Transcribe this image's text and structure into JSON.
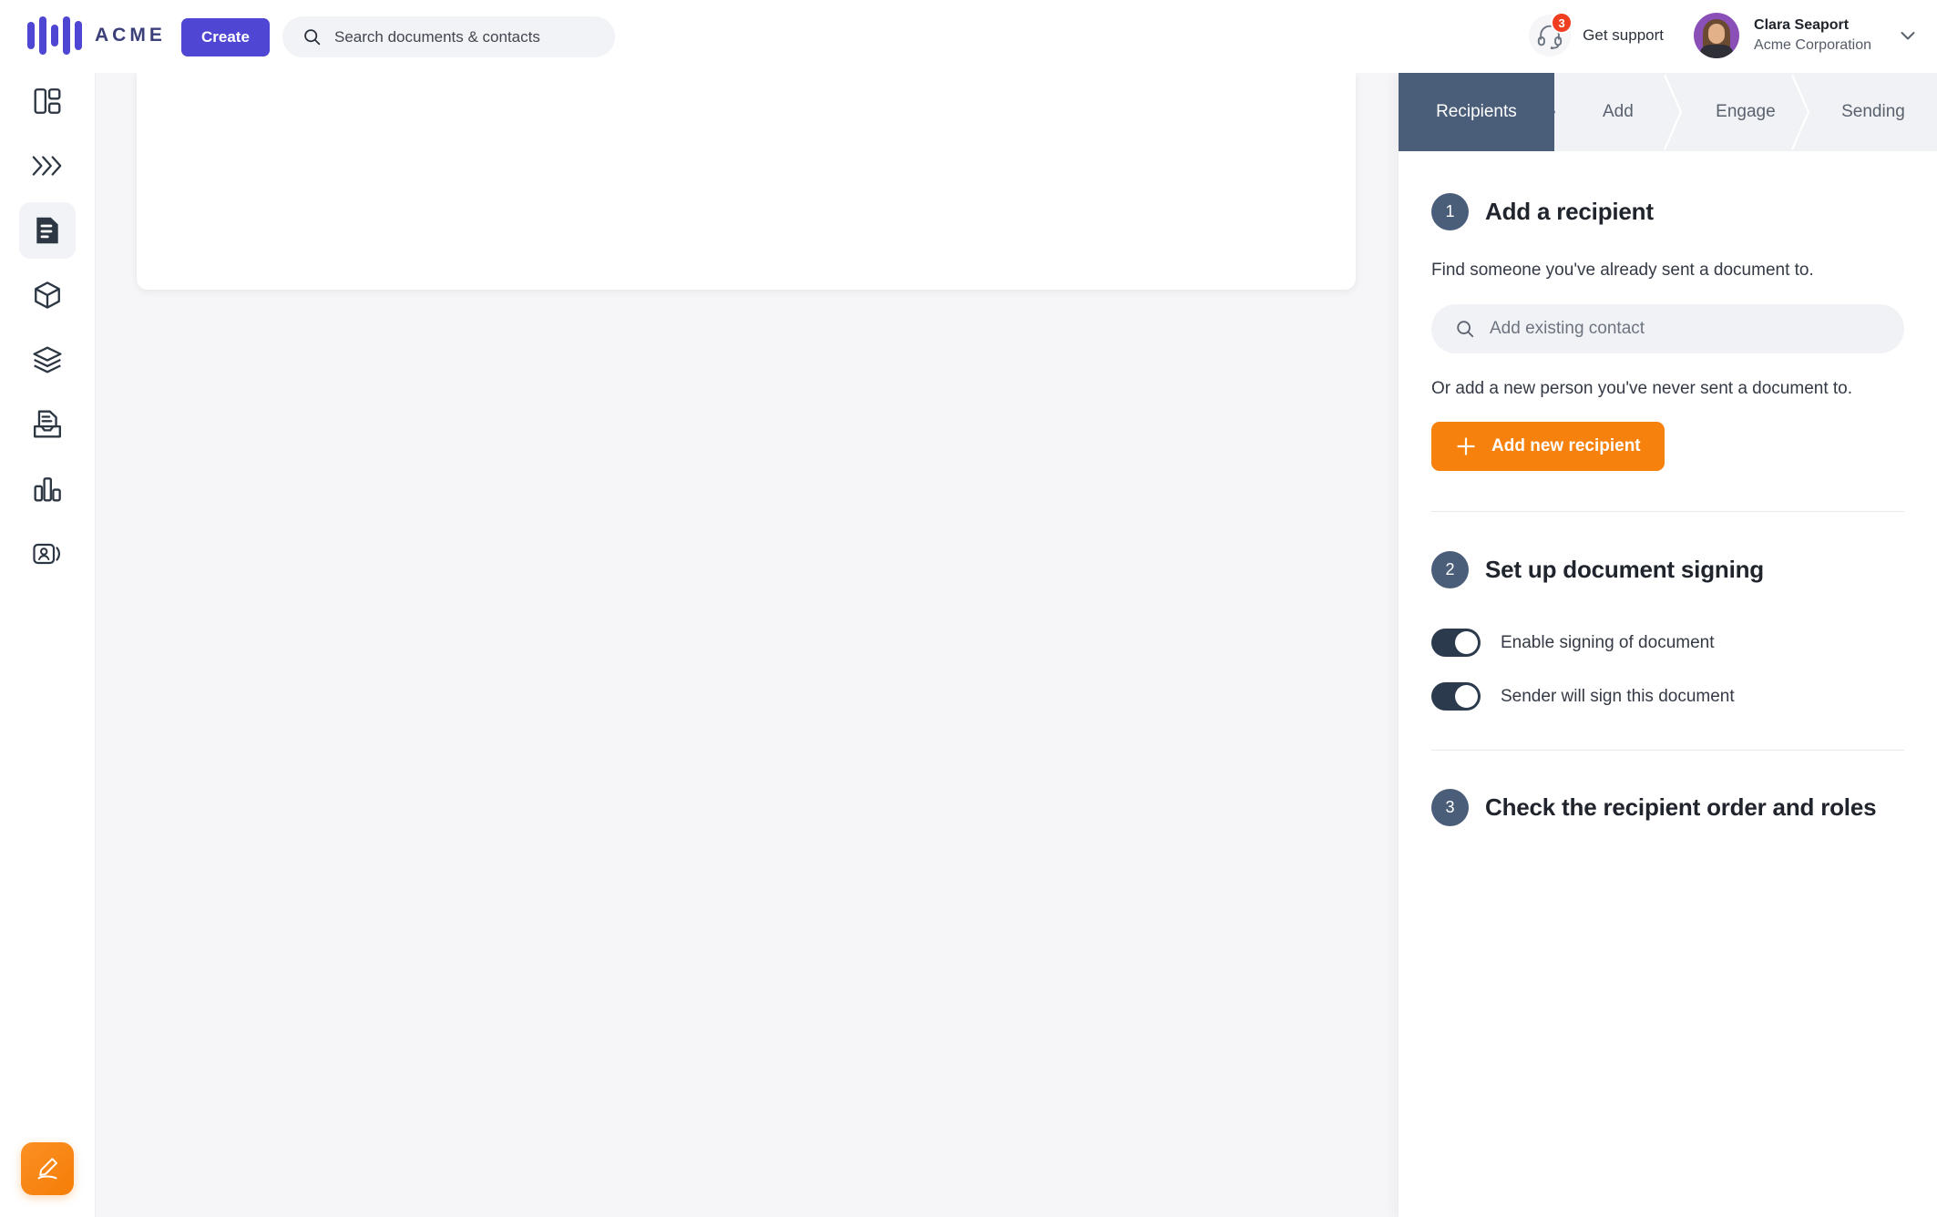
{
  "topbar": {
    "logo_text": "ACME",
    "logo_color": "#4f46d4",
    "create_label": "Create",
    "search_placeholder": "Search documents & contacts",
    "search_icon": "search-icon",
    "support_label": "Get support",
    "support_icon": "headset-icon",
    "support_badge_count": "3",
    "support_badge_color": "#ef3f20",
    "user_name": "Clara Seaport",
    "user_org": "Acme Corporation",
    "user_chevron_icon": "chevron-down-icon"
  },
  "sidebar": {
    "items": [
      {
        "name": "dashboard",
        "icon": "layout-dashboard-icon",
        "active": false
      },
      {
        "name": "workflows",
        "icon": "chevrons-right-icon",
        "active": false
      },
      {
        "name": "documents",
        "icon": "document-icon",
        "active": true
      },
      {
        "name": "products",
        "icon": "box-icon",
        "active": false
      },
      {
        "name": "templates",
        "icon": "layers-icon",
        "active": false
      },
      {
        "name": "inbox",
        "icon": "inbox-document-icon",
        "active": false
      },
      {
        "name": "analytics",
        "icon": "bar-chart-icon",
        "active": false
      },
      {
        "name": "contacts",
        "icon": "contact-card-icon",
        "active": false
      }
    ],
    "fab_icon": "pencil-sign-icon",
    "fab_color": "#f57d07"
  },
  "panel": {
    "steps": [
      {
        "label": "Recipients",
        "active": true
      },
      {
        "label": "Add",
        "active": false
      },
      {
        "label": "Engage",
        "active": false
      },
      {
        "label": "Sending",
        "active": false
      }
    ],
    "active_step_color": "#4a5e79",
    "section1": {
      "number": "1",
      "title": "Add a recipient",
      "helper": "Find someone you've already sent a document to.",
      "search_placeholder": "Add existing contact",
      "search_icon": "search-icon",
      "helper2": "Or add a new person you've never sent a document to.",
      "add_button_label": "Add new recipient",
      "add_button_icon": "plus-icon",
      "add_button_color": "#f6810c"
    },
    "section2": {
      "number": "2",
      "title": "Set up document signing",
      "toggles": [
        {
          "label": "Enable signing of document",
          "on": true
        },
        {
          "label": "Sender will sign this document",
          "on": true
        }
      ]
    },
    "section3": {
      "number": "3",
      "title": "Check the recipient order and roles"
    }
  }
}
